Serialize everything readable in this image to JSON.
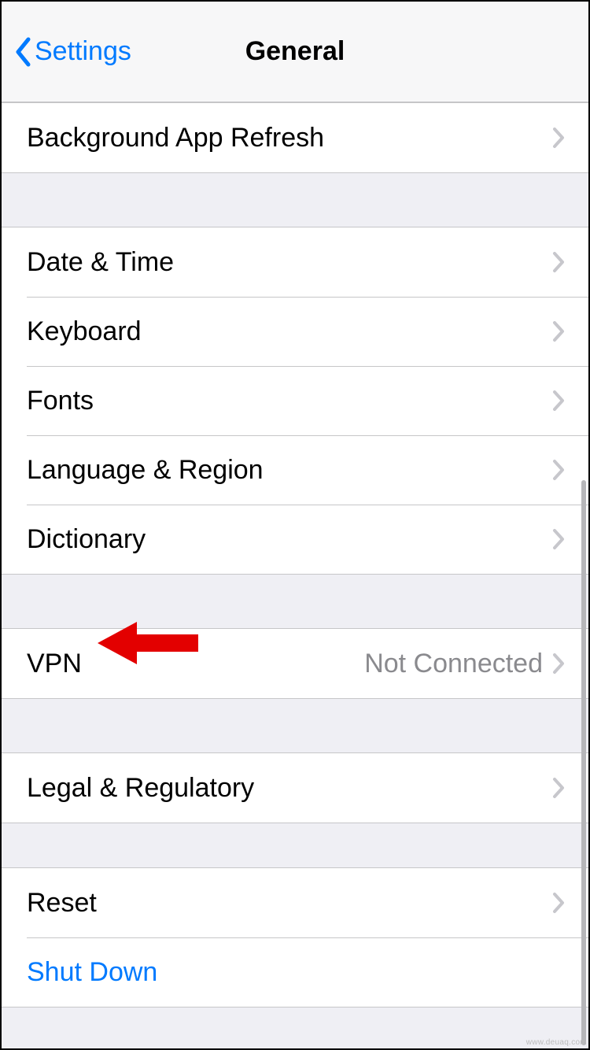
{
  "nav": {
    "back_label": "Settings",
    "title": "General"
  },
  "rows": {
    "background_app_refresh": "Background App Refresh",
    "date_time": "Date & Time",
    "keyboard": "Keyboard",
    "fonts": "Fonts",
    "language_region": "Language & Region",
    "dictionary": "Dictionary",
    "vpn": "VPN",
    "vpn_status": "Not Connected",
    "legal": "Legal & Regulatory",
    "reset": "Reset",
    "shut_down": "Shut Down"
  },
  "watermark": "www.deuaq.com"
}
